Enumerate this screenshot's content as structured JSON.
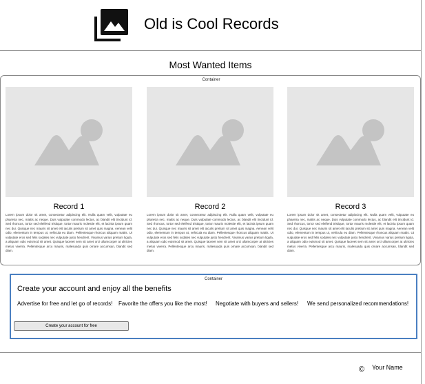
{
  "header": {
    "title": "Old is Cool Records",
    "logo_icon": "image-gallery-icon"
  },
  "section": {
    "title": "Most Wanted Items"
  },
  "records_container": {
    "caption": "Container",
    "cards": [
      {
        "name": "Record 1",
        "image_icon": "image-placeholder-icon",
        "description": "Lorem ipsum dolor sit amet, consectetur adipiscing elit. Nulla quam velit, vulputate eu pharetra nec, mattis ac neque. Duis vulputate commodo lectus, ac blandit elit tincidunt id. Sed rhoncus, tortor sed eleifend tristique, tortor mauris molestie elit, et lacinia ipsum quam nec dui. Quisque nec mauris sit amet elit iaculis pretium sit amet quis magna. Aenean velit odio, elementum in tempus ut, vehicula eu diam. Pellentesque rhoncus aliquam mattis. Ut vulputate eros sed felis sodales nec vulputate justo hendrerit. Vivamus varius pretium ligula, a aliquam odio euismod sit amet. Quisque laoreet sem sit amet orci ullamcorper at ultricies metus viverra. Pellentesque arcu mauris, malesuada quis ornare accumsan, blandit sed diam."
      },
      {
        "name": "Record 2",
        "image_icon": "image-placeholder-icon",
        "description": "Lorem ipsum dolor sit amet, consectetur adipiscing elit. Nulla quam velit, vulputate eu pharetra nec, mattis ac neque. Duis vulputate commodo lectus, ac blandit elit tincidunt id. Sed rhoncus, tortor sed eleifend tristique, tortor mauris molestie elit, et lacinia ipsum quam nec dui. Quisque nec mauris sit amet elit iaculis pretium sit amet quis magna. Aenean velit odio, elementum in tempus ut, vehicula eu diam. Pellentesque rhoncus aliquam mattis. Ut vulputate eros sed felis sodales nec vulputate justo hendrerit. Vivamus varius pretium ligula, a aliquam odio euismod sit amet. Quisque laoreet sem sit amet orci ullamcorper at ultricies metus viverra. Pellentesque arcu mauris, malesuada quis ornare accumsan, blandit sed diam."
      },
      {
        "name": "Record 3",
        "image_icon": "image-placeholder-icon",
        "description": "Lorem ipsum dolor sit amet, consectetur adipiscing elit. Nulla quam velit, vulputate eu pharetra nec, mattis ac neque. Duis vulputate commodo lectus, ac blandit elit tincidunt id. Sed rhoncus, tortor sed eleifend tristique, tortor mauris molestie elit, et lacinia ipsum quam nec dui. Quisque nec mauris sit amet elit iaculis pretium sit amet quis magna. Aenean velit odio, elementum in tempus ut, vehicula eu diam. Pellentesque rhoncus aliquam mattis. Ut vulputate eros sed felis sodales nec vulputate justo hendrerit. Vivamus varius pretium ligula, a aliquam odio euismod sit amet. Quisque laoreet sem sit amet orci ullamcorper at ultricies metus viverra. Pellentesque arcu mauris, malesuada quis ornare accumsan, blandit sed diam."
      }
    ]
  },
  "signup_container": {
    "caption": "Container",
    "title": "Create your account and enjoy all the benefits",
    "benefits": [
      "Advertise for free and let go of records!",
      "Favorite the offers you like the most!",
      "Negotiate with buyers and sellers!",
      "We send personalized recommendations!"
    ],
    "button_label": "Create your account for free",
    "border_color": "#4a7fc1"
  },
  "footer": {
    "copyright_symbol": "©",
    "name": "Your Name"
  }
}
